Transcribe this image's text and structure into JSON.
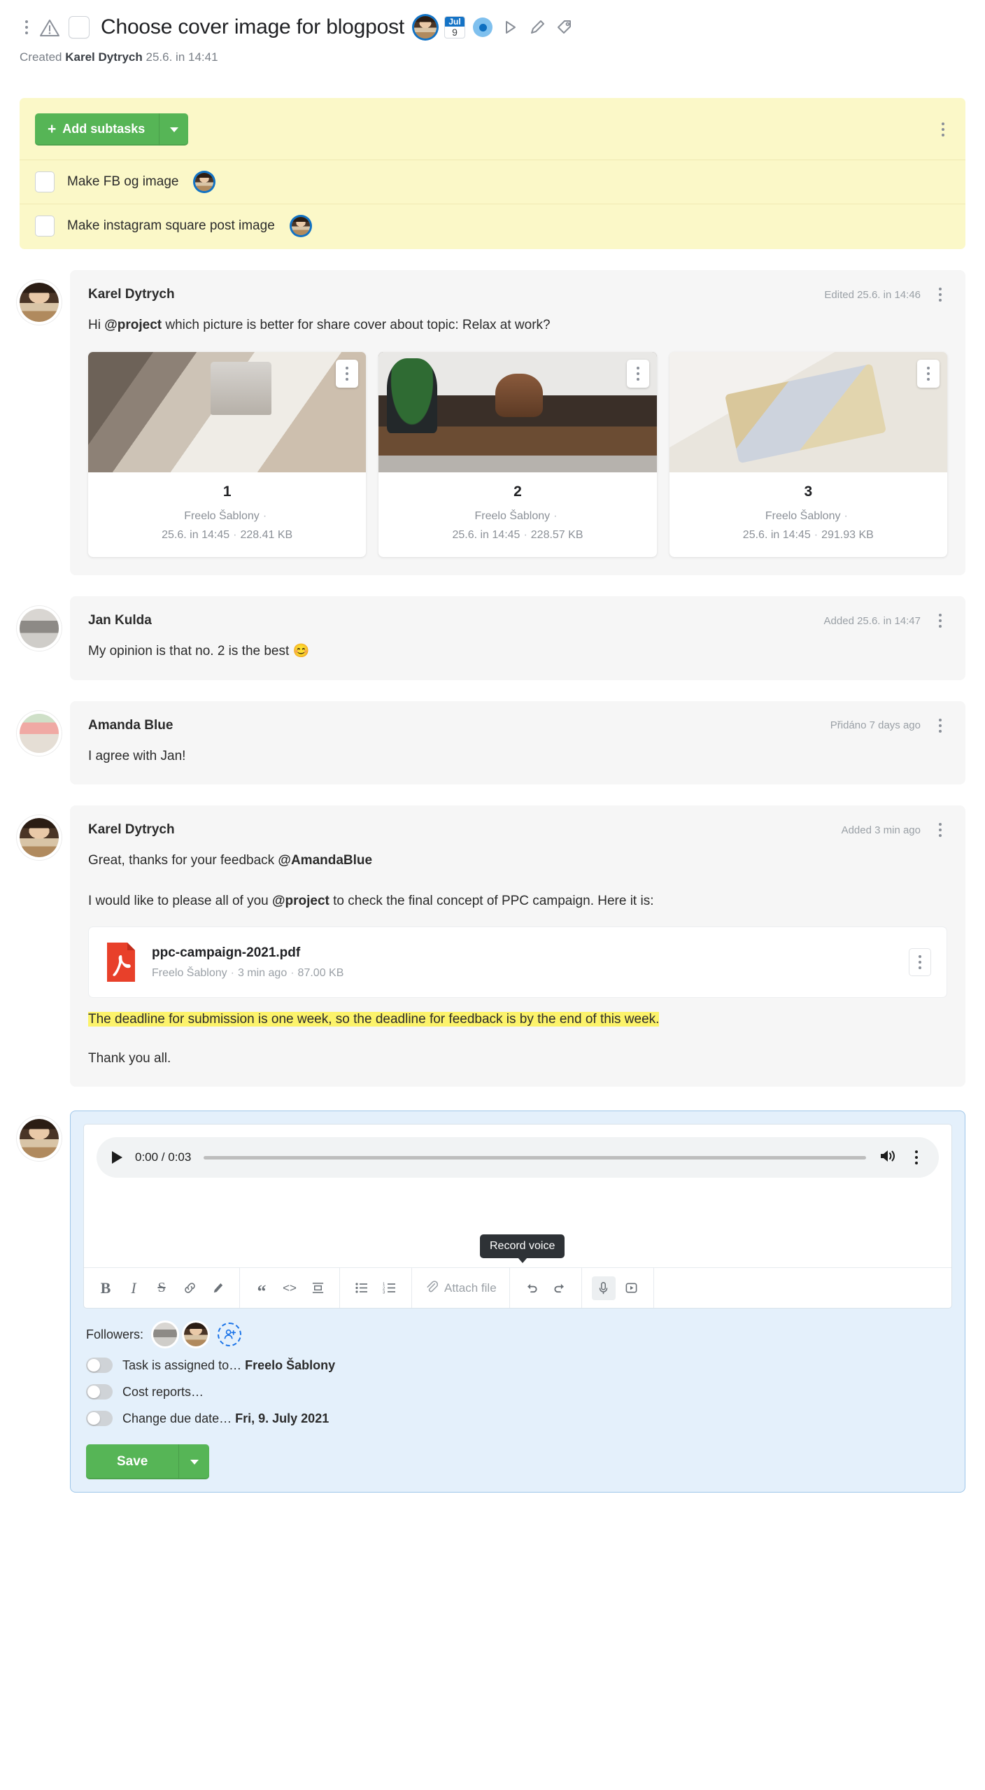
{
  "header": {
    "title": "Choose cover image for blogpost",
    "icons": [
      "menu-dots-icon",
      "warning-icon",
      "task-checkbox",
      "assignee-avatar",
      "due-date-icon",
      "state-icon",
      "timer-icon",
      "edit-icon",
      "label-icon"
    ],
    "calendar": {
      "month": "Jul",
      "day": "9"
    },
    "created_prefix": "Created",
    "created_author": "Karel Dytrych",
    "created_time": "25.6. in 14:41"
  },
  "subtasks": {
    "add_label": "Add subtasks",
    "items": [
      {
        "label": "Make FB og image",
        "checked": false,
        "avatar": "karel"
      },
      {
        "label": "Make instagram square post image",
        "checked": false,
        "avatar": "karel"
      }
    ]
  },
  "comments": [
    {
      "author": "Karel Dytrych",
      "meta": "Edited 25.6. in 14:46",
      "avatar": "karel",
      "text_parts": [
        {
          "t": "Hi ",
          "b": false
        },
        {
          "t": "@project",
          "b": true
        },
        {
          "t": " which picture is better for share cover about topic: Relax at work?",
          "b": false
        }
      ],
      "images": [
        {
          "num": "1",
          "source": "Freelo Šablony",
          "time": "25.6. in 14:45",
          "size": "228.41 KB"
        },
        {
          "num": "2",
          "source": "Freelo Šablony",
          "time": "25.6. in 14:45",
          "size": "228.57 KB"
        },
        {
          "num": "3",
          "source": "Freelo Šablony",
          "time": "25.6. in 14:45",
          "size": "291.93 KB"
        }
      ]
    },
    {
      "author": "Jan Kulda",
      "meta": "Added 25.6. in 14:47",
      "avatar": "jan",
      "text": "My opinion is that no. 2 is the best 😊"
    },
    {
      "author": "Amanda Blue",
      "meta": "Přidáno 7 days ago",
      "avatar": "amanda",
      "text": "I agree with Jan!"
    },
    {
      "author": "Karel Dytrych",
      "meta": "Added 3 min ago",
      "avatar": "karel",
      "line1_a": "Great, thanks for your feedback ",
      "line1_b": "@AmandaBlue",
      "line2_a": "I would like to please all of you ",
      "line2_b": "@project",
      "line2_c": " to check the final concept of PPC campaign. Here it is:",
      "file": {
        "name": "ppc-campaign-2021.pdf",
        "source": "Freelo Šablony",
        "time": "3 min ago",
        "size": "87.00 KB"
      },
      "highlight": "The deadline for submission is one week, so the deadline for feedback is by the end of this week.",
      "closing": "Thank you all."
    }
  ],
  "editor": {
    "audio": {
      "current": "0:00",
      "total": "0:03",
      "time_display": "0:00 / 0:03"
    },
    "toolbar": {
      "bold": "B",
      "italic": "I",
      "strike": "S",
      "link_icon": "link-icon",
      "highlight_icon": "highlighter-icon",
      "quote_icon": "blockquote-icon",
      "code_icon": "code-icon",
      "block_icon": "block-icon",
      "ul_icon": "bullet-list-icon",
      "ol_icon": "numbered-list-icon",
      "attach_label": "Attach file",
      "undo_icon": "undo-icon",
      "redo_icon": "redo-icon",
      "mic_icon": "microphone-icon",
      "video_icon": "record-video-icon",
      "tooltip": "Record voice"
    },
    "followers_label": "Followers:",
    "followers": [
      "jan",
      "karel"
    ],
    "toggles": [
      {
        "label": "Task is assigned to…",
        "value": "Freelo Šablony",
        "on": false
      },
      {
        "label": "Cost reports…",
        "value": "",
        "on": false
      },
      {
        "label": "Change due date…",
        "value": "Fri, 9. July 2021",
        "on": false
      }
    ],
    "save_label": "Save"
  },
  "colors": {
    "green": "#56b556",
    "subtask_bg": "#fbf8c8",
    "editor_bg": "#e4f0fb",
    "highlight": "#fcf36b",
    "blue": "#1473c6"
  }
}
